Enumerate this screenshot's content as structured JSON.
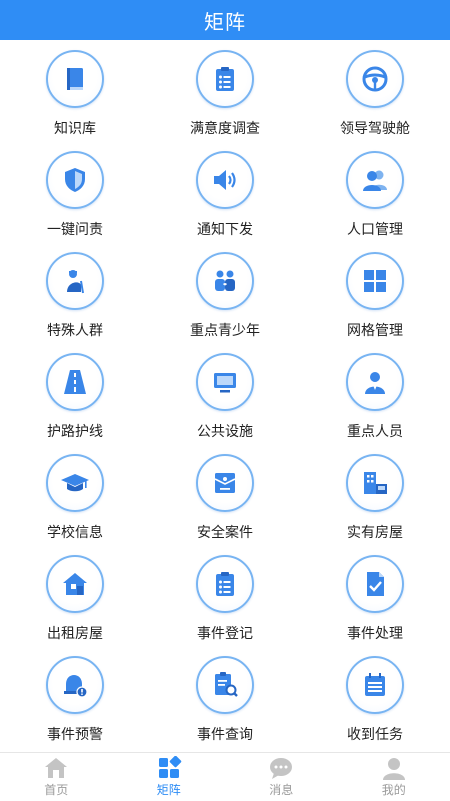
{
  "header": {
    "title": "矩阵"
  },
  "grid": {
    "items": [
      {
        "label": "知识库",
        "icon": "book-icon"
      },
      {
        "label": "满意度调查",
        "icon": "clipboard-checklist-icon"
      },
      {
        "label": "领导驾驶舱",
        "icon": "steering-wheel-icon"
      },
      {
        "label": "一键问责",
        "icon": "shield-icon"
      },
      {
        "label": "通知下发",
        "icon": "speaker-icon"
      },
      {
        "label": "人口管理",
        "icon": "people-icon"
      },
      {
        "label": "特殊人群",
        "icon": "elderly-person-icon"
      },
      {
        "label": "重点青少年",
        "icon": "youth-pair-icon"
      },
      {
        "label": "网格管理",
        "icon": "grid-icon"
      },
      {
        "label": "护路护线",
        "icon": "road-icon"
      },
      {
        "label": "公共设施",
        "icon": "monitor-icon"
      },
      {
        "label": "重点人员",
        "icon": "person-badge-icon"
      },
      {
        "label": "学校信息",
        "icon": "graduation-cap-icon"
      },
      {
        "label": "安全案件",
        "icon": "case-envelope-icon"
      },
      {
        "label": "实有房屋",
        "icon": "building-icon"
      },
      {
        "label": "出租房屋",
        "icon": "house-icon"
      },
      {
        "label": "事件登记",
        "icon": "clipboard-register-icon"
      },
      {
        "label": "事件处理",
        "icon": "document-check-icon"
      },
      {
        "label": "事件预警",
        "icon": "alarm-warning-icon"
      },
      {
        "label": "事件查询",
        "icon": "document-search-icon"
      },
      {
        "label": "收到任务",
        "icon": "calendar-list-icon"
      }
    ]
  },
  "tabbar": {
    "tabs": [
      {
        "label": "首页",
        "icon": "home-icon",
        "active": false
      },
      {
        "label": "矩阵",
        "icon": "matrix-icon",
        "active": true
      },
      {
        "label": "消息",
        "icon": "chat-bubble-icon",
        "active": false
      },
      {
        "label": "我的",
        "icon": "user-icon",
        "active": false
      }
    ]
  },
  "colors": {
    "primary": "#2f8df5",
    "icon_blue": "#3a86e8",
    "ring": "#78b4f2",
    "tab_inactive": "#9a9a9a"
  }
}
